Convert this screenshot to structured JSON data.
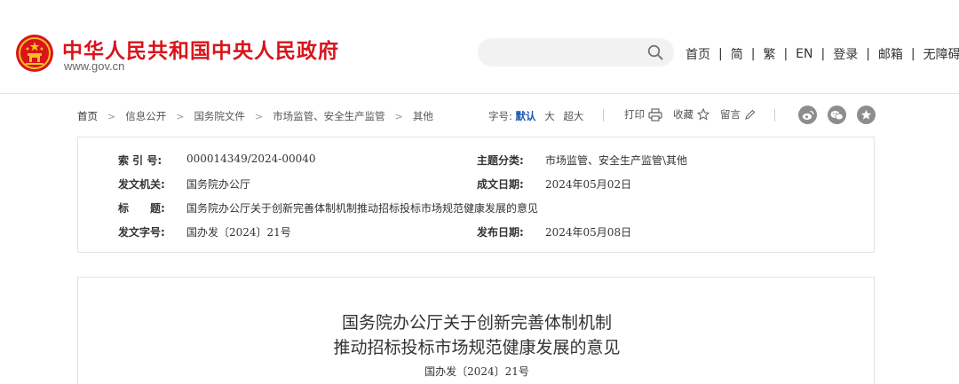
{
  "header": {
    "site_title": "中华人民共和国中央人民政府",
    "site_url": "www.gov.cn",
    "search": {
      "placeholder": "",
      "icon": "search-icon"
    },
    "nav": [
      "首页",
      "简",
      "繁",
      "EN",
      "登录",
      "邮箱",
      "无障碍"
    ]
  },
  "breadcrumb": [
    "首页",
    "信息公开",
    "国务院文件",
    "市场监管、安全生产监管",
    "其他"
  ],
  "font_size": {
    "label": "字号:",
    "default": "默认",
    "big": "大",
    "xbig": "超大"
  },
  "tools": {
    "print": "打印",
    "favorite": "收藏",
    "comment": "留言"
  },
  "share": [
    "weibo-icon",
    "wechat-icon",
    "qzone-icon"
  ],
  "meta": {
    "index_label": "索 引 号:",
    "index_value": "000014349/2024-00040",
    "topic_label": "主题分类:",
    "topic_value": "市场监管、安全生产监管\\其他",
    "issuer_label": "发文机关:",
    "issuer_value": "国务院办公厅",
    "date_label": "成文日期:",
    "date_value": "2024年05月02日",
    "title_label": "标　　题:",
    "title_value": "国务院办公厅关于创新完善体制机制推动招标投标市场规范健康发展的意见",
    "docno_label": "发文字号:",
    "docno_value": "国办发〔2024〕21号",
    "pubdate_label": "发布日期:",
    "pubdate_value": "2024年05月08日"
  },
  "article": {
    "title_line1": "国务院办公厅关于创新完善体制机制",
    "title_line2": "推动招标投标市场规范健康发展的意见",
    "doc_number": "国办发〔2024〕21号"
  },
  "colors": {
    "brand_red": "#d9141b",
    "link_blue": "#1a56b3",
    "icon_gray": "#8d8d8d"
  }
}
